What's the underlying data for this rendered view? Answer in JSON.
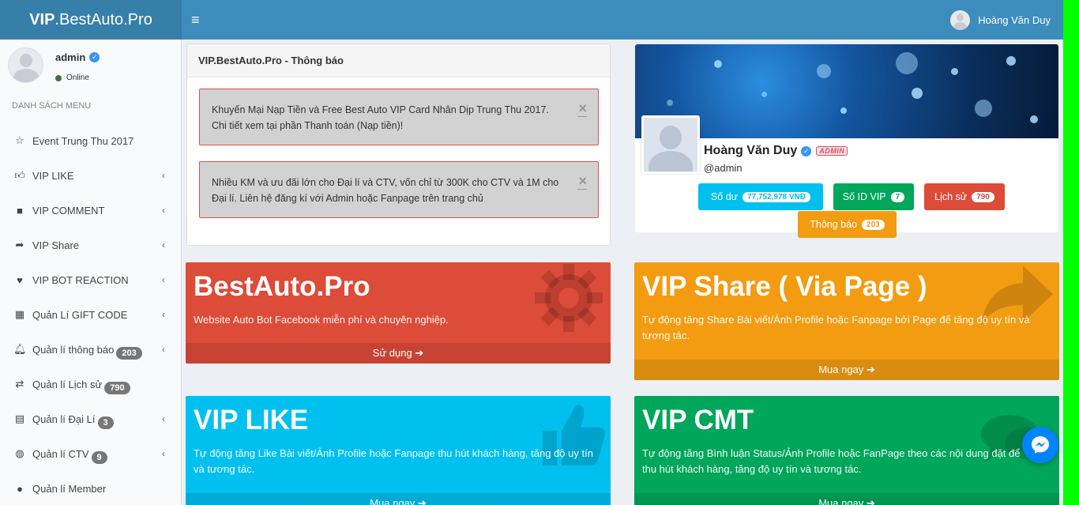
{
  "brand": {
    "bold": "VIP",
    "rest": ".BestAuto.Pro"
  },
  "navbar": {
    "user_name": "Hoàng Văn Duy"
  },
  "user_panel": {
    "name": "admin",
    "status": "Online"
  },
  "sidebar": {
    "header": "DANH SÁCH MENU",
    "items": [
      {
        "label": "Event Trung Thu 2017",
        "icon": "star-icon",
        "badge": null,
        "chevron": false
      },
      {
        "label": "VIP LIKE",
        "icon": "thumbs-up-icon",
        "badge": null,
        "chevron": true
      },
      {
        "label": "VIP COMMENT",
        "icon": "comment-icon",
        "badge": null,
        "chevron": true
      },
      {
        "label": "VIP Share",
        "icon": "share-icon",
        "badge": null,
        "chevron": true
      },
      {
        "label": "VIP BOT REACTION",
        "icon": "heart-icon",
        "badge": null,
        "chevron": true
      },
      {
        "label": "Quản Lí GIFT CODE",
        "icon": "gift-icon",
        "badge": null,
        "chevron": true
      },
      {
        "label": "Quản lí thông báo",
        "icon": "bell-icon",
        "badge": "203",
        "chevron": true
      },
      {
        "label": "Quản lí Lịch sử",
        "icon": "retweet-icon",
        "badge": "790",
        "chevron": false
      },
      {
        "label": "Quản lí Đại Lí",
        "icon": "book-icon",
        "badge": "3",
        "chevron": true
      },
      {
        "label": "Quản lí CTV",
        "icon": "globe-icon",
        "badge": "9",
        "chevron": true
      },
      {
        "label": "Quản lí Member",
        "icon": "user-icon",
        "badge": null,
        "chevron": false
      }
    ]
  },
  "notice_panel": {
    "title": "VIP.BestAuto.Pro - Thông báo",
    "alerts": [
      "Khuyến Mại Nạp Tiền và Free Best Auto VIP Card Nhân Dịp Trung Thu 2017. Chi tiết xem tại phần Thanh toán (Nạp tiền)!",
      "Nhiều KM và ưu đãi lớn cho Đại lí và CTV, vốn chỉ từ 300K cho CTV và 1M cho Đại lí. Liên hệ đăng kí với Admin hoặc Fanpage trên trang chủ"
    ],
    "close_symbol": "×"
  },
  "profile": {
    "name": "Hoàng Văn Duy",
    "tag": "ADMIN",
    "handle": "@admin",
    "buttons": [
      {
        "label": "Số dư",
        "count": "77,752,978 VNĐ",
        "color": "#00c0ef"
      },
      {
        "label": "Số ID VIP",
        "count": "7",
        "color": "#00a65a"
      },
      {
        "label": "Lịch sử",
        "count": "790",
        "color": "#dd4b39"
      },
      {
        "label": "Thông báo",
        "count": "203",
        "color": "#f39c12"
      }
    ]
  },
  "boxes": [
    {
      "title": "BestAuto.Pro",
      "desc": "Website Auto Bot Facebook miễn phí và chuyên nghiệp.",
      "footer": "Sử dụng",
      "color": "#dd4b39",
      "icon": "gear-icon"
    },
    {
      "title": "VIP Share ( Via Page )",
      "desc": "Tự động tăng Share Bài viết/Ảnh Profile hoặc Fanpage bởi Page để tăng độ uy tín và tương tác.",
      "footer": "Mua ngay",
      "color": "#f39c12",
      "icon": "share-arrow-icon"
    },
    {
      "title": "VIP LIKE",
      "desc": "Tự động tăng Like Bài viết/Ảnh Profile hoặc Fanpage thu hút khách hàng, tăng độ uy tín và tương tác.",
      "footer": "Mua ngay",
      "color": "#00c0ef",
      "icon": "thumbs-up-icon"
    },
    {
      "title": "VIP CMT",
      "desc": "Tự động tăng Bình luận Status/Ảnh Profile hoặc FanPage theo các nội dung đặt để thu hút khách hàng, tăng độ uy tín và tương tác.",
      "footer": "Mua ngay",
      "color": "#00a65a",
      "icon": "comments-icon"
    }
  ]
}
